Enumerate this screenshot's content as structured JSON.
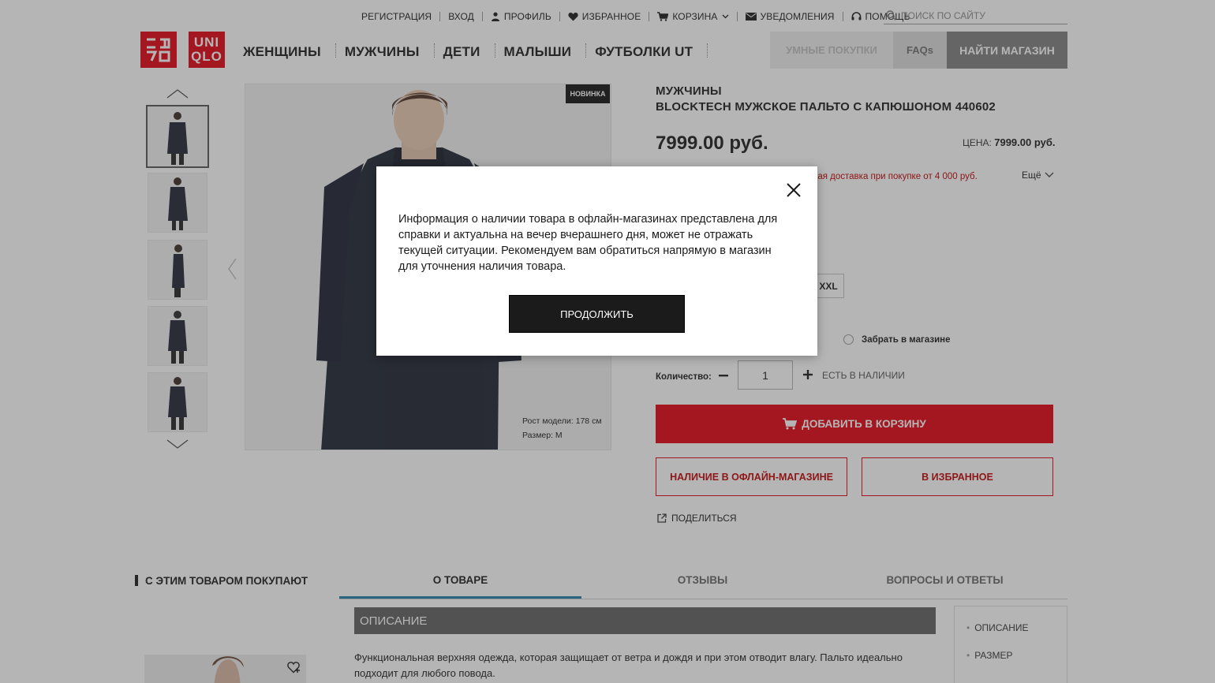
{
  "utility_nav": {
    "register": "РЕГИСТРАЦИЯ",
    "login": "ВХОД",
    "profile": "ПРОФИЛЬ",
    "favorites": "ИЗБРАННОЕ",
    "cart": "КОРЗИНА",
    "notifications": "УВЕДОМЛЕНИЯ",
    "help": "ПОМОЩЬ"
  },
  "search": {
    "placeholder": "ПОИСК ПО САЙТУ"
  },
  "logo": {
    "kana": "ユニクロ",
    "text_top": "UNI",
    "text_bottom": "QLO"
  },
  "main_nav": [
    "ЖЕНЩИНЫ",
    "МУЖЧИНЫ",
    "ДЕТИ",
    "МАЛЫШИ",
    "ФУТБОЛКИ UT"
  ],
  "right_buttons": {
    "smart": "УМНЫЕ ПОКУПКИ",
    "faq": "FAQs",
    "find_store": "НАЙТИ МАГАЗИН"
  },
  "gallery": {
    "badge": "НОВИНКА",
    "model_height": "Рост модели: 178 см",
    "model_size": "Размер: M"
  },
  "product": {
    "category": "МУЖЧИНЫ",
    "name": "BLOCKTECH МУЖСКОЕ ПАЛЬТО С КАПЮШОНОМ 440602",
    "price": "7999.00 руб.",
    "price_label": "ЦЕНА:",
    "price_small": "7999.00 руб.",
    "promo": "ная доставка при покупке от 4 000 руб.",
    "more": "Ещё",
    "size_xxl": "XXL",
    "pickup": "Забрать в магазине",
    "qty_label": "Количество:",
    "qty_value": "1",
    "stock": "ЕСТЬ В НАЛИЧИИ",
    "add_to_cart": "ДОБАВИТЬ В КОРЗИНУ",
    "offline_availability": "НАЛИЧИЕ В ОФЛАЙН-МАГАЗИНЕ",
    "add_to_favorites": "В ИЗБРАННОЕ",
    "share": "ПОДЕЛИТЬСЯ"
  },
  "bottom": {
    "also_bought": "С ЭТИМ ТОВАРОМ ПОКУПАЮТ",
    "tabs": [
      "О ТОВАРЕ",
      "ОТЗЫВЫ",
      "ВОПРОСЫ И ОТВЕТЫ"
    ],
    "desc_title": "ОПИСАНИЕ",
    "desc_text": "Функциональная верхняя одежда, которая защищает от ветра и дождя и при этом отводит влагу. Пальто идеально подходит для любого повода.",
    "side_nav": [
      "ОПИСАНИЕ",
      "РАЗМЕР"
    ]
  },
  "modal": {
    "text": "Информация о наличии товара в офлайн-магазинах представлена для справки и актуальна на вечер вчерашнего дня, может не отражать текущей ситуации. Рекомендуем вам обратиться напрямую в магазин для уточнения наличия товара.",
    "continue": "ПРОДОЛЖИТЬ"
  },
  "colors": {
    "brand_red": "#e4000f",
    "dark": "#1b1b1b",
    "tab_accent": "#1f7fa8",
    "overlay": "rgba(60,60,60,0.38)"
  }
}
